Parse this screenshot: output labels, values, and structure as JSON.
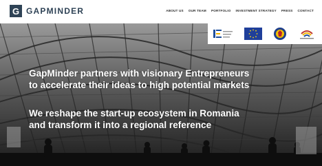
{
  "brand": {
    "name": "GAPMINDER",
    "logo_letter": "G",
    "color": "#2f4356"
  },
  "nav": [
    {
      "label": "ABOUT US"
    },
    {
      "label": "OUR TEAM"
    },
    {
      "label": "PORTFOLIO"
    },
    {
      "label": "INVESTMENT STRATEGY"
    },
    {
      "label": "PRESS"
    },
    {
      "label": "CONTACT"
    }
  ],
  "partners": [
    {
      "icon": "structural-funds-logo"
    },
    {
      "icon": "eu-flag-logo"
    },
    {
      "icon": "romanian-government-logo"
    },
    {
      "icon": "program-logo"
    }
  ],
  "hero": {
    "headline_1": [
      "GapMinder partners with visionary Entrepreneurs",
      "to accelerate their ideas to high potential markets"
    ],
    "headline_2": [
      "We reshape the start-up ecosystem in Romania",
      "and transform it into a regional reference"
    ]
  }
}
